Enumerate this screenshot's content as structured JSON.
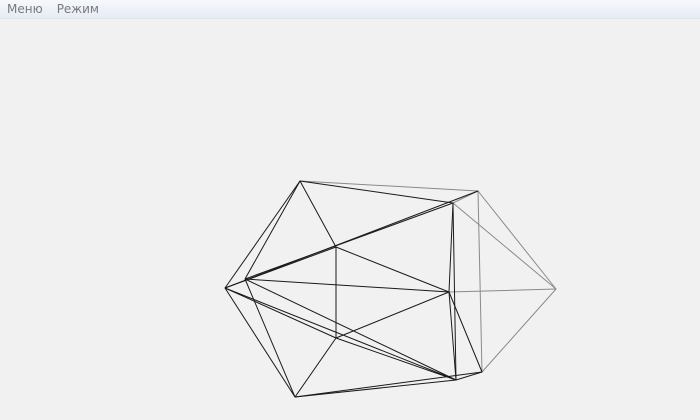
{
  "menubar": {
    "items": [
      {
        "label": "Меню"
      },
      {
        "label": "Режим"
      }
    ]
  },
  "viewport": {
    "object": "wireframe-icosahedron",
    "background_color": "#f1f1f1",
    "edge_color": "#000000"
  }
}
